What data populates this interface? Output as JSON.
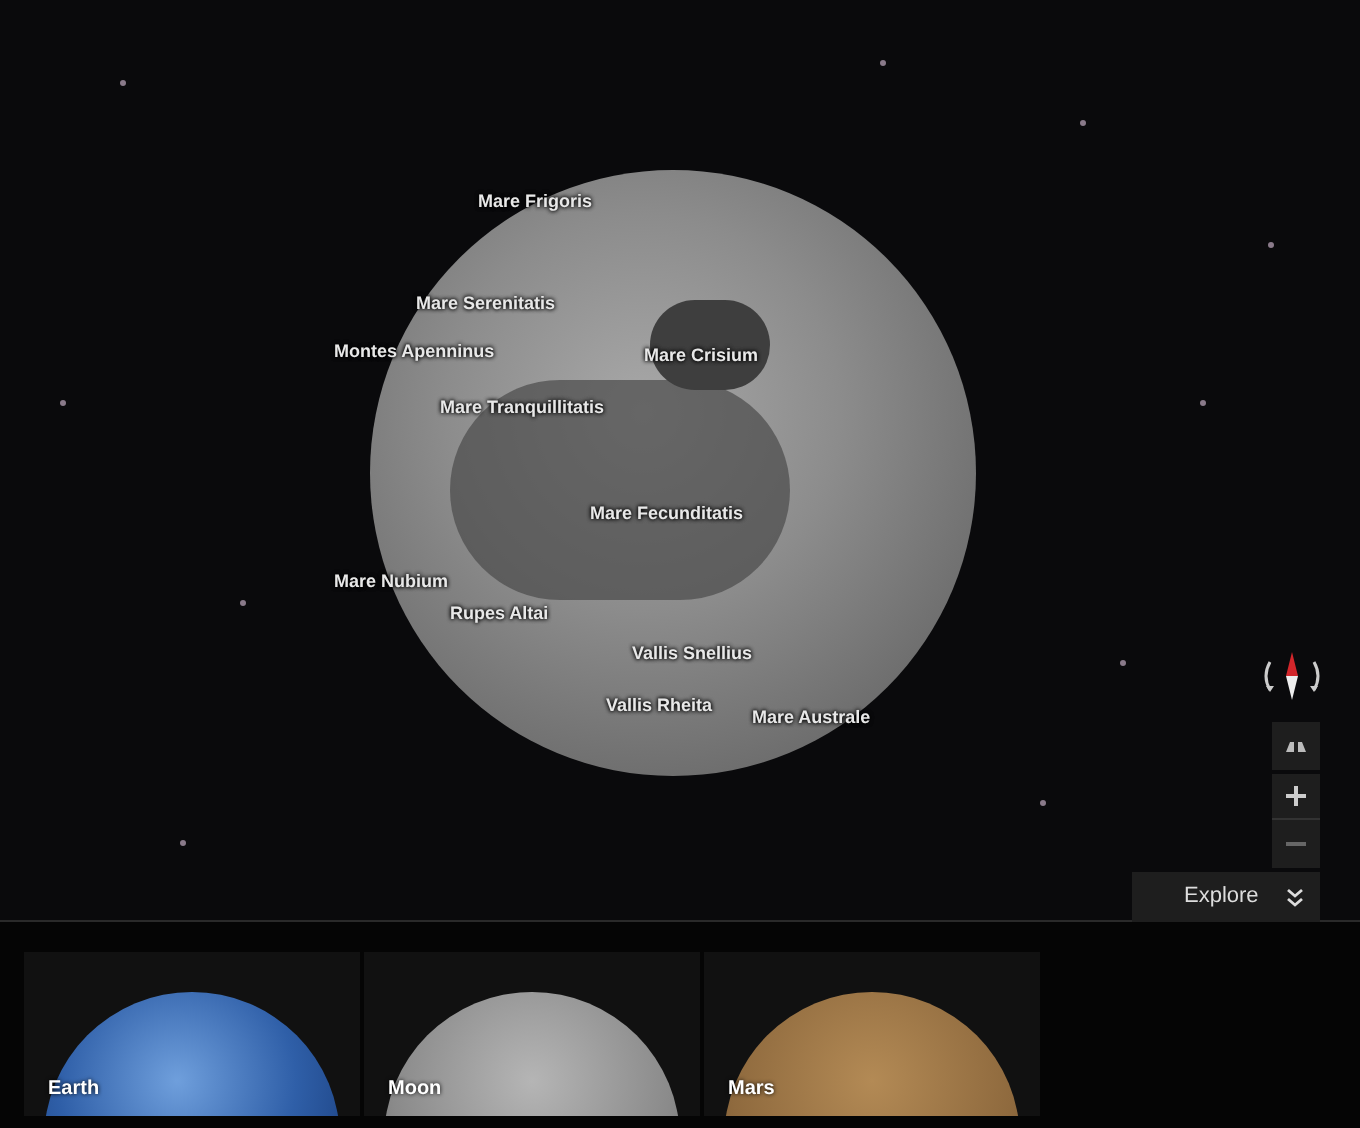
{
  "map_labels": [
    "Mare Frigoris",
    "Mare Serenitatis",
    "Montes Apenninus",
    "Mare Crisium",
    "Mare Tranquillitatis",
    "Mare Fecunditatis",
    "Mare Nubium",
    "Rupes Altai",
    "Vallis Snellius",
    "Vallis Rheita",
    "Mare Australe"
  ],
  "explore": {
    "label": "Explore"
  },
  "planet_cards": [
    {
      "label": "Earth",
      "kind": "earth"
    },
    {
      "label": "Moon",
      "kind": "moon"
    },
    {
      "label": "Mars",
      "kind": "mars"
    }
  ]
}
